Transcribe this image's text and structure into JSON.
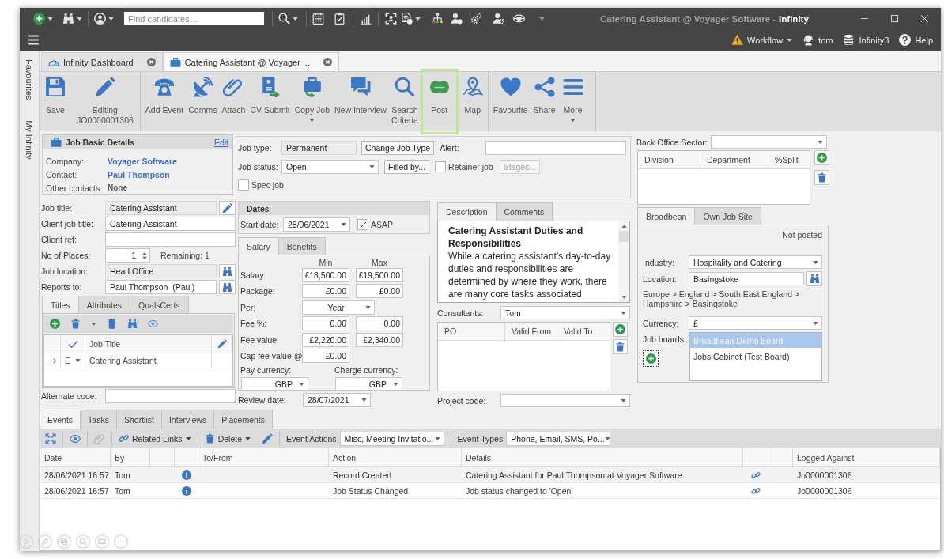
{
  "title_bar": {
    "search": {
      "placeholder": "Find candidates…"
    },
    "record": "Catering Assistant @ Voyager Software -",
    "app_name": "Infinity"
  },
  "menu_bar": {
    "items": [
      {
        "label": "Workflow",
        "dropdown": true
      },
      {
        "label": "tom",
        "dropdown": false
      },
      {
        "label": "Infinity3",
        "dropdown": false
      },
      {
        "label": "Help",
        "dropdown": false
      }
    ]
  },
  "side_tabs": [
    "Favourites",
    "My Infinity"
  ],
  "document_tabs": [
    {
      "label": "Infinity Dashboard",
      "selected": false
    },
    {
      "label": "Catering Assistant @ Voyager ...",
      "selected": true
    }
  ],
  "ribbon": {
    "groups": [
      {
        "buttons": [
          {
            "label": "Save",
            "dropdown": false,
            "highlighted": false
          },
          {
            "label": "Editing\nJO0000001306",
            "dropdown": false,
            "highlighted": false
          }
        ]
      },
      {
        "buttons": [
          {
            "label": "Add Event",
            "dropdown": false,
            "highlighted": false
          },
          {
            "label": "Comms",
            "dropdown": false,
            "highlighted": false
          },
          {
            "label": "Attach",
            "dropdown": false,
            "highlighted": false
          },
          {
            "label": "CV Submit",
            "dropdown": false,
            "highlighted": false
          },
          {
            "label": "Copy Job",
            "dropdown": true,
            "highlighted": false
          },
          {
            "label": "New Interview",
            "dropdown": false,
            "highlighted": false
          },
          {
            "label": "Search\nCriteria",
            "dropdown": false,
            "highlighted": false
          },
          {
            "label": "Post",
            "dropdown": false,
            "highlighted": true
          },
          {
            "label": "Map",
            "dropdown": false,
            "highlighted": false
          }
        ]
      },
      {
        "buttons": [
          {
            "label": "Favourite",
            "dropdown": false,
            "highlighted": false
          },
          {
            "label": "Share",
            "dropdown": false,
            "highlighted": false
          },
          {
            "label": "More",
            "dropdown": true,
            "highlighted": false
          }
        ]
      }
    ]
  },
  "job_basic_details": {
    "title": "Job Basic Details",
    "edit_link": "Edit",
    "rows": [
      {
        "label": "Company:",
        "value": "Voyager Software",
        "kind": "link"
      },
      {
        "label": "Contact:",
        "value": "Paul Thompson",
        "kind": "link"
      },
      {
        "label": "Other contacts:",
        "value": "None",
        "kind": "plain"
      }
    ]
  },
  "job_fields": [
    {
      "label": "Job title:",
      "value": "Catering Assistant",
      "kind": "edit",
      "readonly": true
    },
    {
      "label": "Client job title:",
      "value": "Catering Assistant",
      "kind": "text",
      "readonly": false
    },
    {
      "label": "Client ref:",
      "kind": "text",
      "readonly": false
    },
    {
      "label": "No of Places:",
      "value": "1",
      "kind": "spinner",
      "readonly": false,
      "note": "Remaining: 1"
    },
    {
      "label": "Job location:",
      "value": "Head Office",
      "kind": "lookup",
      "readonly": true
    },
    {
      "label": "Reports to:",
      "value": "Paul Thompson  (Paul)",
      "kind": "lookup",
      "readonly": false
    }
  ],
  "titles_panel": {
    "tabs": [
      {
        "label": "Titles",
        "selected": true
      },
      {
        "label": "Attributes",
        "selected": false
      },
      {
        "label": "QualsCerts",
        "selected": false
      }
    ],
    "columns": [
      "Job Title"
    ],
    "rows": [
      {
        "type": "E",
        "title": "Catering Assistant",
        "selected": true
      }
    ]
  },
  "alternate_code": {
    "label": "Alternate code:"
  },
  "job_type": {
    "label": "Job type:",
    "value": "Permanent",
    "readonly": true
  },
  "change_job_type_button": "Change Job Type",
  "alert": {
    "label": "Alert:"
  },
  "job_status": {
    "label": "Job status:",
    "value": "Open"
  },
  "filled_by_button": "Filled by...",
  "retainer_job": {
    "label": "Retainer job",
    "checked": false
  },
  "stages_button": {
    "label": "Stages...",
    "disabled": true
  },
  "spec_job": {
    "label": "Spec job",
    "checked": false
  },
  "dates": {
    "title": "Dates",
    "start_date": {
      "label": "Start date:",
      "value": "28/06/2021"
    },
    "asap": {
      "label": "ASAP",
      "checked": true
    }
  },
  "salary": {
    "tabs": [
      {
        "label": "Salary",
        "selected": true
      },
      {
        "label": "Benefits",
        "selected": false
      }
    ],
    "column_headers": [
      "Min",
      "Max"
    ],
    "rows": [
      {
        "label": "Salary:",
        "kind": "range",
        "min": "£18,500.00",
        "max": "£19,500.00"
      },
      {
        "label": "Package:",
        "kind": "range",
        "min": "£0.00",
        "max": "£0.00"
      },
      {
        "label": "Per:",
        "kind": "select",
        "value": "Year"
      },
      {
        "label": "Fee %:",
        "kind": "range",
        "min": "0.00",
        "max": "0.00"
      },
      {
        "label": "Fee value:",
        "kind": "range",
        "min": "£2,220.00",
        "max": "£2,340.00"
      },
      {
        "label": "Cap fee value @",
        "kind": "single",
        "value": "£0.00"
      }
    ],
    "currencies": [
      {
        "label": "Pay currency:",
        "value": "GBP"
      },
      {
        "label": "Charge currency:",
        "value": "GBP"
      }
    ]
  },
  "review_date": {
    "label": "Review date:",
    "value": "28/07/2021"
  },
  "description": {
    "tabs": [
      {
        "label": "Description",
        "selected": true
      },
      {
        "label": "Comments",
        "selected": false
      }
    ],
    "heading": "Catering Assistant Duties and Responsibilities",
    "body": "While a catering assistant’s day-to-day duties and responsibilities are determined by where they work, there are many core tasks associated"
  },
  "consultants": {
    "label": "Consultants:",
    "value": "Tom"
  },
  "po_grid": {
    "columns": [
      "PO",
      "Valid From",
      "Valid To"
    ]
  },
  "project_code": {
    "label": "Project code:"
  },
  "back_office": {
    "label": "Back Office Sector:",
    "columns": [
      "Division",
      "Department",
      "%Split"
    ]
  },
  "posting": {
    "tabs": [
      {
        "label": "Broadbean",
        "selected": true
      },
      {
        "label": "Own Job Site",
        "selected": false
      }
    ],
    "status": "Not posted",
    "industry": {
      "label": "Industry:",
      "value": "Hospitality and Catering"
    },
    "location": {
      "label": "Location:",
      "value": "Basingstoke"
    },
    "location_path": "Europe > England > South East England > Hampshire > Basingstoke",
    "currency": {
      "label": "Currency:",
      "value": "£"
    },
    "job_boards": {
      "label": "Job boards:",
      "add_button": {
        "focused": true
      },
      "items": [
        {
          "name": "Broadbean Demo Board",
          "selected": true
        },
        {
          "name": "Jobs Cabinet (Test Board)",
          "selected": false
        }
      ]
    }
  },
  "activity": {
    "tabs": [
      {
        "label": "Events",
        "selected": true
      },
      {
        "label": "Tasks",
        "selected": false
      },
      {
        "label": "Shortlist",
        "selected": false
      },
      {
        "label": "Interviews",
        "selected": false
      },
      {
        "label": "Placements",
        "selected": false
      }
    ],
    "toolbar": {
      "icon_buttons": [
        {
          "disabled": false
        },
        {
          "disabled": false
        },
        {
          "disabled": true
        }
      ],
      "related_links": "Related Links",
      "delete": "Delete",
      "event_actions": {
        "label": "Event Actions",
        "value": "Misc, Meeting Invitatio..."
      },
      "event_types": {
        "label": "Event Types",
        "value": "Phone, Email, SMS, Po..."
      }
    },
    "columns": [
      "Date",
      "By",
      "To/From",
      "Action",
      "Details",
      "Logged Against"
    ],
    "rows": [
      {
        "date": "28/06/2021 16:57",
        "by": "Tom",
        "action": "Record Created",
        "details": "Catering Assistant for Paul Thompson at Voyager Software",
        "logged_against": "Jo0000001306",
        "selected": true
      },
      {
        "date": "28/06/2021 16:57",
        "by": "Tom",
        "action": "Job Status Changed",
        "details": "Job status changed to 'Open'",
        "logged_against": "Jo0000001306",
        "selected": false
      }
    ]
  }
}
